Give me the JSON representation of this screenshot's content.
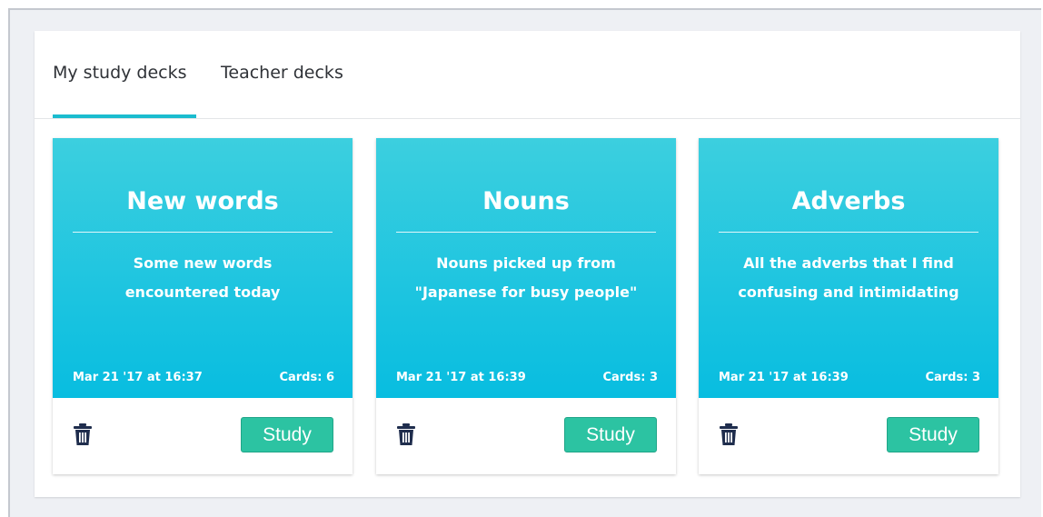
{
  "tabs": [
    {
      "label": "My study decks"
    },
    {
      "label": "Teacher decks"
    }
  ],
  "decks": [
    {
      "title": "New words",
      "description": "Some new words encountered today",
      "date": "Mar 21 '17 at 16:37",
      "cards": "Cards: 6",
      "study_label": "Study"
    },
    {
      "title": "Nouns",
      "description": "Nouns picked up from \"Japanese for busy people\"",
      "date": "Mar 21 '17 at 16:39",
      "cards": "Cards: 3",
      "study_label": "Study"
    },
    {
      "title": "Adverbs",
      "description": "All the adverbs that I find confusing and intimidating",
      "date": "Mar 21 '17 at 16:39",
      "cards": "Cards: 3",
      "study_label": "Study"
    }
  ],
  "icons": {
    "delete": "trash-icon"
  },
  "colors": {
    "accent": "#1bbccf",
    "study_button": "#2cc3a2",
    "deck_header": "#08bde0"
  }
}
